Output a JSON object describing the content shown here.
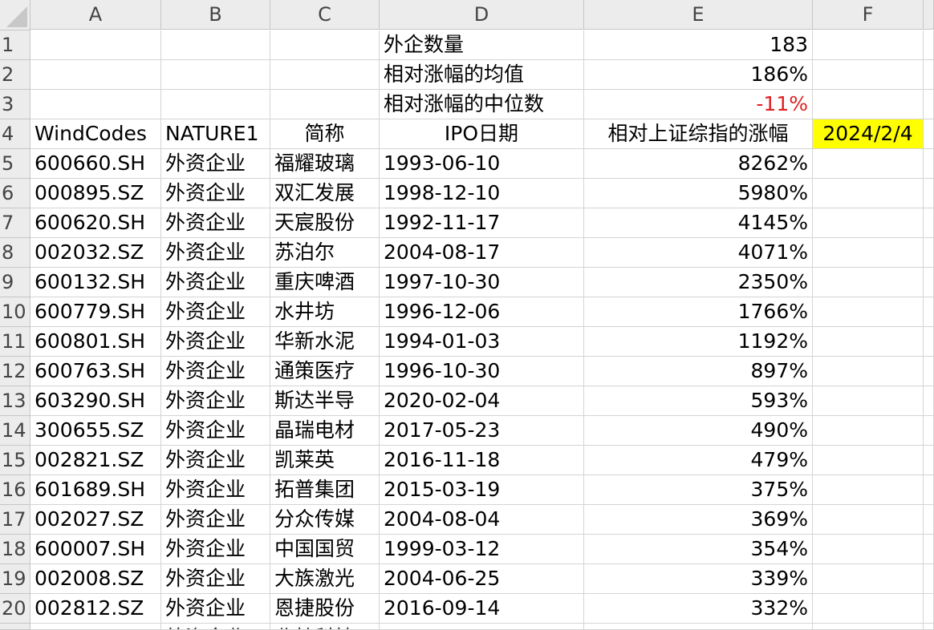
{
  "columns": [
    "A",
    "B",
    "C",
    "D",
    "E",
    "F"
  ],
  "summary": [
    {
      "row": "1",
      "label": "外企数量",
      "value": "183",
      "negative": false
    },
    {
      "row": "2",
      "label": "相对涨幅的均值",
      "value": "186%",
      "negative": false
    },
    {
      "row": "3",
      "label": "相对涨幅的中位数",
      "value": "-11%",
      "negative": true
    }
  ],
  "header_row": {
    "row": "4",
    "windcodes": "WindCodes",
    "nature": "NATURE1",
    "short_name": "简称",
    "ipo_date": "IPO日期",
    "rel_gain": "相对上证综指的涨幅",
    "date_cell": "2024/2/4"
  },
  "rows": [
    {
      "row": "5",
      "code": "600660.SH",
      "nature": "外资企业",
      "name": "福耀玻璃",
      "ipo": "1993-06-10",
      "gain": "8262%"
    },
    {
      "row": "6",
      "code": "000895.SZ",
      "nature": "外资企业",
      "name": "双汇发展",
      "ipo": "1998-12-10",
      "gain": "5980%"
    },
    {
      "row": "7",
      "code": "600620.SH",
      "nature": "外资企业",
      "name": "天宸股份",
      "ipo": "1992-11-17",
      "gain": "4145%"
    },
    {
      "row": "8",
      "code": "002032.SZ",
      "nature": "外资企业",
      "name": "苏泊尔",
      "ipo": "2004-08-17",
      "gain": "4071%"
    },
    {
      "row": "9",
      "code": "600132.SH",
      "nature": "外资企业",
      "name": "重庆啤酒",
      "ipo": "1997-10-30",
      "gain": "2350%"
    },
    {
      "row": "10",
      "code": "600779.SH",
      "nature": "外资企业",
      "name": "水井坊",
      "ipo": "1996-12-06",
      "gain": "1766%"
    },
    {
      "row": "11",
      "code": "600801.SH",
      "nature": "外资企业",
      "name": "华新水泥",
      "ipo": "1994-01-03",
      "gain": "1192%"
    },
    {
      "row": "12",
      "code": "600763.SH",
      "nature": "外资企业",
      "name": "通策医疗",
      "ipo": "1996-10-30",
      "gain": "897%"
    },
    {
      "row": "13",
      "code": "603290.SH",
      "nature": "外资企业",
      "name": "斯达半导",
      "ipo": "2020-02-04",
      "gain": "593%"
    },
    {
      "row": "14",
      "code": "300655.SZ",
      "nature": "外资企业",
      "name": "晶瑞电材",
      "ipo": "2017-05-23",
      "gain": "490%"
    },
    {
      "row": "15",
      "code": "002821.SZ",
      "nature": "外资企业",
      "name": "凯莱英",
      "ipo": "2016-11-18",
      "gain": "479%"
    },
    {
      "row": "16",
      "code": "601689.SH",
      "nature": "外资企业",
      "name": "拓普集团",
      "ipo": "2015-03-19",
      "gain": "375%"
    },
    {
      "row": "17",
      "code": "002027.SZ",
      "nature": "外资企业",
      "name": "分众传媒",
      "ipo": "2004-08-04",
      "gain": "369%"
    },
    {
      "row": "18",
      "code": "600007.SH",
      "nature": "外资企业",
      "name": "中国国贸",
      "ipo": "1999-03-12",
      "gain": "354%"
    },
    {
      "row": "19",
      "code": "002008.SZ",
      "nature": "外资企业",
      "name": "大族激光",
      "ipo": "2004-06-25",
      "gain": "339%"
    },
    {
      "row": "20",
      "code": "002812.SZ",
      "nature": "外资企业",
      "name": "恩捷股份",
      "ipo": "2016-09-14",
      "gain": "332%"
    }
  ],
  "partial_row": {
    "nature": "外资企业",
    "name": "北特科技"
  },
  "colors": {
    "highlight": "#ffff00",
    "negative": "#e02020",
    "gridline": "#d4d4d4",
    "header_bg": "#ececec"
  }
}
